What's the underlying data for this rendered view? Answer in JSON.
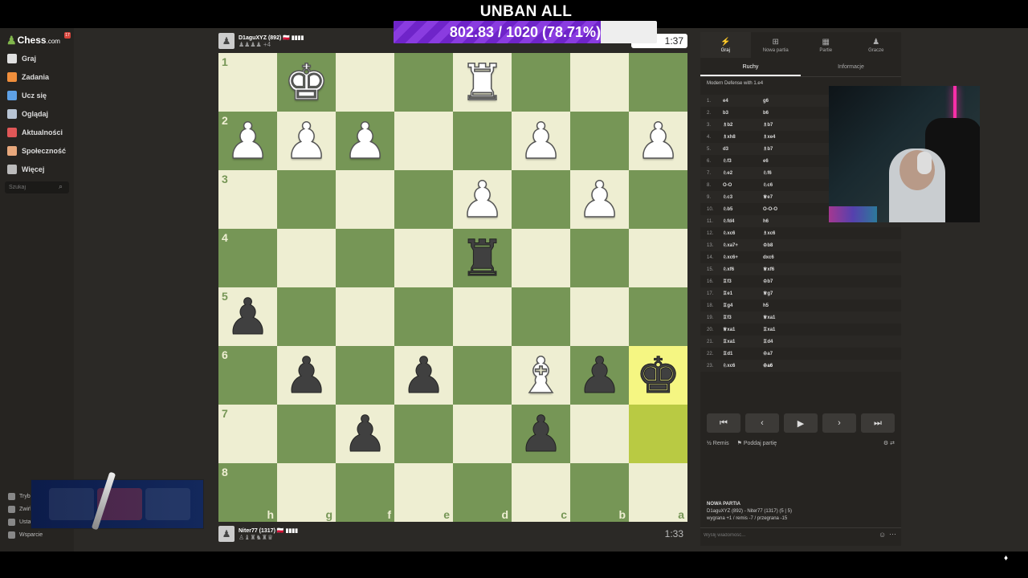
{
  "overlay": {
    "title": "UNBAN ALL",
    "progress_text": "802.83 / 1020 (78.71%)",
    "progress_fraction": 0.7871
  },
  "sidebar": {
    "logo": "Chess",
    "logo_suffix": ".com",
    "logo_badge": "17",
    "items": [
      {
        "label": "Graj",
        "color": "#e0e0e0"
      },
      {
        "label": "Zadania",
        "color": "#f08e3b"
      },
      {
        "label": "Ucz się",
        "color": "#5ea1e6"
      },
      {
        "label": "Oglądaj",
        "color": "#b8c4d4"
      },
      {
        "label": "Aktualności",
        "color": "#e05757"
      },
      {
        "label": "Społeczność",
        "color": "#e8a87c"
      },
      {
        "label": "Więcej",
        "color": "#bbbbbb"
      }
    ],
    "search_placeholder": "Szukaj",
    "bottom_items": [
      "Tryb",
      "Zwiń",
      "Usta",
      "Wsparcie"
    ]
  },
  "top_player": {
    "name": "D1aguXYZ (892) 🇵🇱 ▮▮▮▮",
    "captured": "♟♟♟♟ +4",
    "clock": "1:37"
  },
  "bottom_player": {
    "name": "Niter77 (1317) 🇵🇱 ▮▮▮▮",
    "captured": "♙♝♜♞♜♛",
    "clock": "1:33"
  },
  "board": {
    "ranks": [
      "1",
      "2",
      "3",
      "4",
      "5",
      "6",
      "7",
      "8"
    ],
    "files": [
      "h",
      "g",
      "f",
      "e",
      "d",
      "c",
      "b",
      "a"
    ],
    "rows": [
      [
        "",
        "K",
        "",
        "",
        "R",
        "",
        "",
        ""
      ],
      [
        "P",
        "P",
        "P",
        "",
        "",
        "P",
        "",
        "P"
      ],
      [
        "",
        "",
        "",
        "",
        "P",
        "",
        "P",
        ""
      ],
      [
        "",
        "",
        "",
        "",
        "r",
        "",
        "",
        ""
      ],
      [
        "p",
        "",
        "",
        "",
        "",
        "",
        "",
        ""
      ],
      [
        "",
        "p",
        "",
        "p",
        "",
        "B",
        "p",
        "k"
      ],
      [
        "",
        "",
        "p",
        "",
        "",
        "p",
        "",
        ""
      ],
      [
        "",
        "",
        "",
        "",
        "",
        "",
        "",
        ""
      ]
    ],
    "highlighted": [
      [
        5,
        7
      ],
      [
        6,
        7
      ]
    ]
  },
  "panel": {
    "tabs": [
      {
        "label": "Graj",
        "icon": "⚡"
      },
      {
        "label": "Nowa partia",
        "icon": "⊞"
      },
      {
        "label": "Partie",
        "icon": "▦"
      },
      {
        "label": "Gracze",
        "icon": "♟"
      }
    ],
    "subtabs": [
      "Ruchy",
      "Informacje"
    ],
    "opening": "Modern Defense with 1.e4",
    "moves": [
      [
        "1.",
        "e4",
        "g6"
      ],
      [
        "2.",
        "b3",
        "b6"
      ],
      [
        "3.",
        "♗b2",
        "♗b7"
      ],
      [
        "4.",
        "♗xh8",
        "♗xe4"
      ],
      [
        "5.",
        "d3",
        "♗b7"
      ],
      [
        "6.",
        "♘f3",
        "e6"
      ],
      [
        "7.",
        "♘e2",
        "♘f6"
      ],
      [
        "8.",
        "O-O",
        "♘c6"
      ],
      [
        "9.",
        "♘c3",
        "♕e7"
      ],
      [
        "10.",
        "♘b5",
        "O-O-O"
      ],
      [
        "11.",
        "♘fd4",
        "h6"
      ],
      [
        "12.",
        "♘xc6",
        "♗xc6"
      ],
      [
        "13.",
        "♘xa7+",
        "♔b8"
      ],
      [
        "14.",
        "♘xc6+",
        "dxc6"
      ],
      [
        "15.",
        "♘xf6",
        "♕xf6"
      ],
      [
        "16.",
        "♖f3",
        "♔b7"
      ],
      [
        "17.",
        "♖e1",
        "♕g7"
      ],
      [
        "18.",
        "♖g4",
        "h5"
      ],
      [
        "19.",
        "♖f3",
        "♕xa1"
      ],
      [
        "20.",
        "♕xa1",
        "♖xa1"
      ],
      [
        "21.",
        "♖xa1",
        "♖d4"
      ],
      [
        "22.",
        "♖d1",
        "♔a7"
      ],
      [
        "23.",
        "♘xc6",
        "♔a6"
      ]
    ],
    "actions": {
      "draw": "½ Remis",
      "resign": "⚑ Poddaj partię"
    },
    "game_info": {
      "title": "NOWA PARTIA",
      "players": "D1aguXYZ (892) - Niter77 (1317) (5 | 5)",
      "stats": "wygrana +1 / remis -7 / przegrana -15"
    },
    "chat_placeholder": "Wyślij wiadomość..."
  }
}
